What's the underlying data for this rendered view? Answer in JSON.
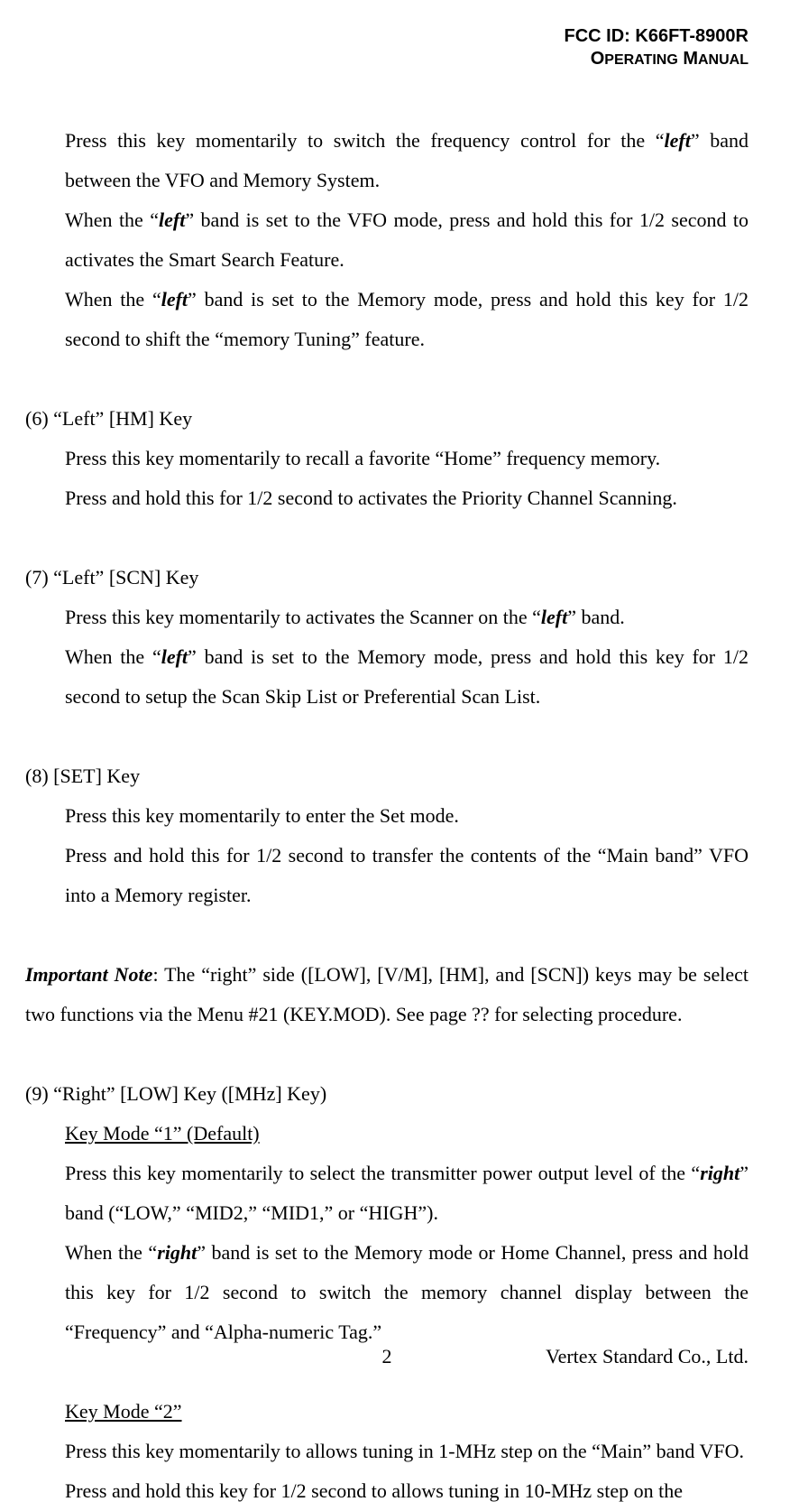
{
  "header": {
    "fcc_id": "FCC ID: K66FT-8900R",
    "manual_prefix": "O",
    "manual_word1_rest": "PERATING",
    "manual_space": " ",
    "manual_word2_first": "M",
    "manual_word2_rest": "ANUAL"
  },
  "sections": {
    "s0": {
      "p1a": "Press this key momentarily to switch the frequency control for the “",
      "p1b": "left",
      "p1c": "” band between the VFO and Memory System.",
      "p2a": "When the “",
      "p2b": "left",
      "p2c": "” band is set to the VFO mode, press and hold this for 1/2 second to activates the Smart Search Feature.",
      "p3a": "When the “",
      "p3b": "left",
      "p3c": "” band is set to the Memory mode, press and hold this key for 1/2 second to shift the “memory Tuning” feature."
    },
    "s6": {
      "title": "(6) “Left” [HM] Key",
      "p1": "Press this key momentarily to recall a favorite “Home” frequency memory.",
      "p2": "Press and hold this for 1/2 second to activates the Priority Channel Scanning."
    },
    "s7": {
      "title": "(7) “Left” [SCN] Key",
      "p1a": "Press this key momentarily to activates the Scanner on the “",
      "p1b": "left",
      "p1c": "” band.",
      "p2a": "When the “",
      "p2b": "left",
      "p2c": "” band is set to the Memory mode, press and hold this key for 1/2 second to setup the Scan Skip List or Preferential Scan List."
    },
    "s8": {
      "title": "(8) [SET] Key",
      "p1": "Press this key momentarily to enter the Set mode.",
      "p2": "Press and hold this for 1/2 second to transfer the contents of the “Main band” VFO into a Memory register."
    },
    "note": {
      "label": "Important Note",
      "text": ": The “right” side ([LOW], [V/M], [HM], and [SCN]) keys may be select two functions via the Menu #21 (KEY.MOD). See page ?? for selecting procedure."
    },
    "s9": {
      "title": "(9) “Right” [LOW] Key ([MHz] Key)",
      "km1": "Key Mode “1” (Default)",
      "p1a": "Press this key momentarily to select the transmitter power output level of the “",
      "p1b": "right",
      "p1c": "” band (“LOW,” “MID2,” “MID1,” or “HIGH”).",
      "p2a": "When the “",
      "p2b": "right",
      "p2c": "” band is set to the Memory mode or Home Channel, press and hold this key for 1/2 second to switch the memory channel display between the “Frequency” and “Alpha-numeric Tag.”",
      "km2": "Key Mode “2”",
      "p3": "Press this key momentarily to allows tuning in 1-MHz step on the “Main” band VFO.",
      "p4": "Press and hold this key for 1/2 second to allows tuning in 10-MHz step on the"
    }
  },
  "footer": {
    "page_number": "2",
    "company": "Vertex Standard Co., Ltd."
  }
}
